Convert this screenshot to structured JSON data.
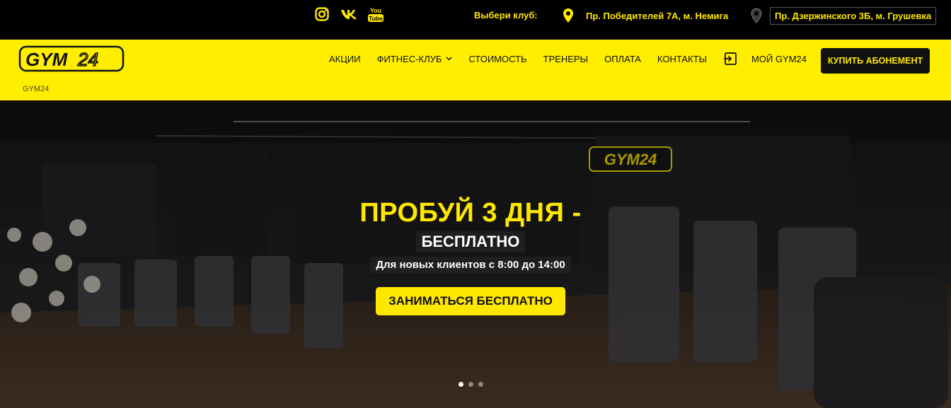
{
  "topbar": {
    "social": [
      {
        "icon": "instagram-icon"
      },
      {
        "icon": "vk-icon"
      },
      {
        "icon": "youtube-icon",
        "text": "You Tube"
      }
    ],
    "club_label": "Выбери клуб:",
    "clubs": [
      {
        "address": "Пр. Победителей 7А, м. Немига"
      },
      {
        "address": "Пр. Дзержинского 3Б, м. Грушевка"
      }
    ]
  },
  "header": {
    "logo_text": "GYM24",
    "nav": [
      {
        "label": "АКЦИИ"
      },
      {
        "label": "ФИТНЕС-КЛУБ"
      },
      {
        "label": "СТОИМОСТЬ"
      },
      {
        "label": "ТРЕНЕРЫ"
      },
      {
        "label": "ОПЛАТА"
      },
      {
        "label": "КОНТАКТЫ"
      },
      {
        "label": "МОЙ GYM24"
      }
    ],
    "buy_label": "КУПИТЬ АБОНЕМЕНТ",
    "breadcrumb": "GYM24"
  },
  "hero": {
    "title": "ПРОБУЙ 3 ДНЯ",
    "title_dash": "-",
    "subtitle": "БЕСПЛАТНО",
    "note": "Для новых клиентов с 8:00 до 14:00",
    "cta": "ЗАНИМАТЬСЯ БЕСПЛАТНО",
    "wall_sign": "GYM24",
    "slides": 3,
    "active_slide": 1
  },
  "colors": {
    "brand_yellow": "#ffee00",
    "accent_yellow": "#ffe800",
    "dark": "#111111"
  }
}
